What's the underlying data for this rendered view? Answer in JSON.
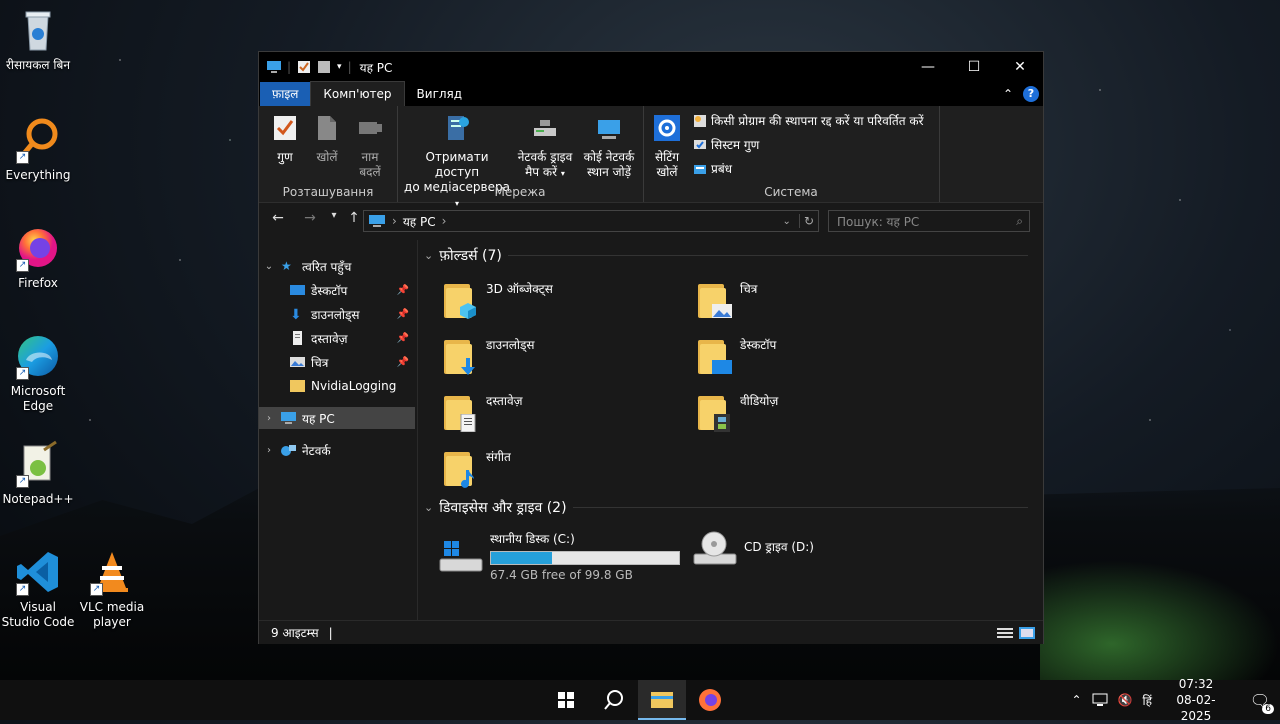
{
  "desktop": {
    "icons": [
      {
        "label": "रीसायकल बिन"
      },
      {
        "label": "Everything"
      },
      {
        "label": "Firefox"
      },
      {
        "label": "Microsoft Edge"
      },
      {
        "label": "Notepad++"
      },
      {
        "label": "Visual Studio Code"
      },
      {
        "label": "VLC media player"
      }
    ]
  },
  "window": {
    "title": "यह PC",
    "tabs": {
      "file": "फ़ाइल",
      "computer": "Комп'ютер",
      "view": "Вигляд"
    },
    "ribbon": {
      "location": {
        "label": "Розташування",
        "properties": "गुण",
        "open": "खोलें",
        "rename_line1": "नाम",
        "rename_line2": "बदलें"
      },
      "network": {
        "label": "Мережа",
        "media_line1": "Отримати доступ",
        "media_line2": "до медіасервера",
        "map_line1": "नेटवर्क ड्राइव",
        "map_line2": "मैप करें",
        "add_line1": "कोई नेटवर्क",
        "add_line2": "स्थान जोड़ें"
      },
      "system": {
        "label": "Система",
        "settings_line1": "सेटिंग",
        "settings_line2": "खोलें",
        "uninstall": "किसी प्रोग्राम की स्थापना रद्द करें या परिवर्तित करें",
        "sysprops": "सिस्टम गुण",
        "manage": "प्रबंध"
      }
    },
    "address": {
      "path": "यह PC",
      "search_placeholder": "Пошук: यह PC"
    },
    "sidebar": {
      "quick_access": "त्वरित पहुँच",
      "items": [
        {
          "label": "डेस्कटॉप"
        },
        {
          "label": "डाउनलोड्स"
        },
        {
          "label": "दस्तावेज़"
        },
        {
          "label": "चित्र"
        },
        {
          "label": "NvidiaLogging"
        }
      ],
      "this_pc": "यह PC",
      "network": "नेटवर्क"
    },
    "folders_header": "फ़ोल्डर्स (7)",
    "folders": [
      {
        "label": "3D ऑब्जेक्ट्स"
      },
      {
        "label": "चित्र"
      },
      {
        "label": "डाउनलोड्स"
      },
      {
        "label": "डेस्कटॉप"
      },
      {
        "label": "दस्तावेज़"
      },
      {
        "label": "वीडियोज़"
      },
      {
        "label": "संगीत"
      }
    ],
    "drives_header": "डिवाइसेस और ड्राइव (2)",
    "drives": [
      {
        "label": "स्थानीय डिस्क (C:)",
        "free": "67.4 GB free of 99.8 GB",
        "used_fraction": 0.325
      },
      {
        "label": "CD ड्राइव (D:)"
      }
    ],
    "status": "9 आइटम्स"
  },
  "taskbar": {
    "lang": "हिं",
    "time": "07:32",
    "date": "08-02-2025",
    "notifications": "6"
  },
  "colors": {
    "accent": "#1a5fb4",
    "progress": "#26a0da"
  }
}
